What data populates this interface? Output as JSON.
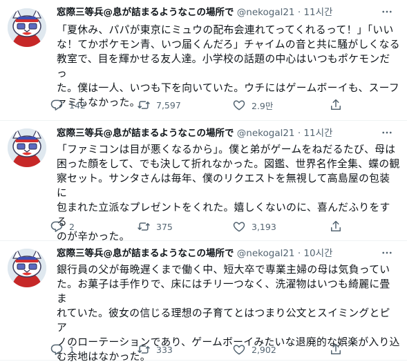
{
  "tweets": [
    {
      "author": "窓際三等兵@息が詰まるようなこの場所で",
      "handle": "@nekogal21",
      "dot": "·",
      "time": "11시간",
      "text": "「夏休み、パパが東京にミュウの配布会連れてってくれるって！」「いいな！てかポケモン青、いつ届くんだろ」チャイムの音と共に騒がしくなる\n教室で、目を輝かせる友人達。小学校の話題の中心はいつもポケモンだっ\nた。僕は一人、いつも下を向いていた。ウチにはゲームボーイも、スーフ\nァミもなかった。",
      "replies": "142",
      "retweets": "7,597",
      "likes": "2.9만"
    },
    {
      "author": "窓際三等兵@息が詰まるようなこの場所で",
      "handle": "@nekogal21",
      "dot": "·",
      "time": "11시간",
      "text": "「ファミコンは目が悪くなるから」。僕と弟がゲームをねだるたび、母は\n困った顔をして、でも決して折れなかった。図鑑、世界名作全集、蝶の観\n察セット。サンタさんは毎年、僕のリクエストを無視して高島屋の包装に\n包まれた立派なプレゼントをくれた。嬉しくないのに、喜んだふりをする\nのが辛かった。",
      "replies": "2",
      "retweets": "375",
      "likes": "3,193"
    },
    {
      "author": "窓際三等兵@息が詰まるようなこの場所で",
      "handle": "@nekogal21",
      "dot": "·",
      "time": "10시간",
      "text": "銀行員の父が毎晩遅くまで働く中、短大卒で専業主婦の母は気負ってい\nた。お菓子は手作りで、床にはチリ一つなく、洗濯物はいつも綺麗に畳ま\nれていた。彼女の信じる理想の子育てとはつまり公文とスイミングとピア\nノのローテーションであり、ゲームボーイみたいな退廃的な娯楽が入り込\nむ余地はなかった。",
      "replies": "1",
      "retweets": "333",
      "likes": "2,902"
    }
  ],
  "icons": {
    "avatar": "cat-avatar-icon",
    "more": "more-icon",
    "reply": "reply-icon",
    "retweet": "retweet-icon",
    "like": "heart-icon",
    "share": "share-icon"
  },
  "colors": {
    "text": "#0f1419",
    "secondary": "#536471",
    "divider": "#eff3f4"
  }
}
